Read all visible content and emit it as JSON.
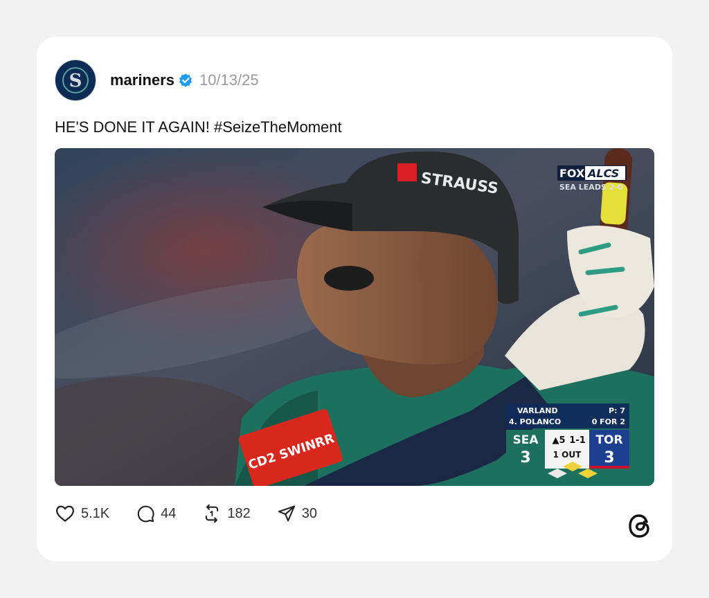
{
  "post": {
    "username": "mariners",
    "date": "10/13/25",
    "text": "HE'S DONE IT AGAIN! #SeizeTheMoment"
  },
  "media": {
    "helmet_sponsor": "STRAUSS",
    "sleeve_patch": "CD2 SWINRR",
    "broadcast": {
      "network": "FOX",
      "series": "ALCS",
      "series_status": "SEA LEADS 2-0"
    },
    "scorebug": {
      "pitcher": "VARLAND",
      "pitch_count": "P: 7",
      "batter": "4. POLANCO",
      "batter_stats": "0 FOR 2",
      "away_team": "SEA",
      "away_score": "3",
      "inning": "▲5",
      "count": "1-1",
      "outs": "1 OUT",
      "home_team": "TOR",
      "home_score": "3"
    }
  },
  "actions": {
    "likes": "5.1K",
    "replies": "44",
    "reposts": "182",
    "shares": "30"
  },
  "icons": {
    "avatar": "mariners-logo",
    "verified": "verified-badge-icon",
    "like": "heart-icon",
    "reply": "comment-icon",
    "repost": "repost-icon",
    "share": "send-icon",
    "brand": "threads-logo-icon"
  },
  "colors": {
    "verified": "#1d9bf0",
    "card_bg": "#ffffff",
    "page_bg": "#f2f2f2",
    "date": "#9a9a9a"
  }
}
